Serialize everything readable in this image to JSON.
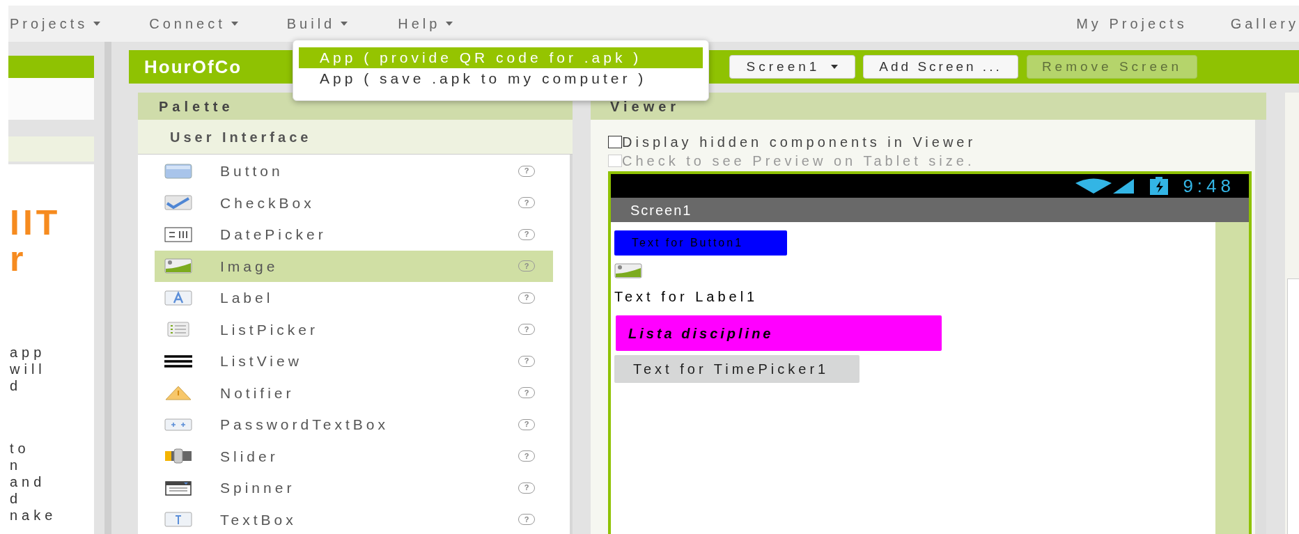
{
  "menu_bar": {
    "items": [
      {
        "label": "Projects"
      },
      {
        "label": "Connect"
      },
      {
        "label": "Build"
      },
      {
        "label": "Help"
      }
    ],
    "right_links": [
      {
        "label": "My Projects"
      },
      {
        "label": "Gallery"
      }
    ]
  },
  "build_menu": {
    "items": [
      {
        "label": "App ( provide QR code for .apk )",
        "selected": true
      },
      {
        "label": "App ( save .apk to my computer )",
        "selected": false
      }
    ]
  },
  "left_panel": {
    "heading_lines": [
      "IIT",
      "r"
    ],
    "text_lines": [
      "app",
      "will",
      "d",
      "to",
      "n",
      "and",
      "d",
      "nake"
    ]
  },
  "toolbar": {
    "project_name": "HourOfCo",
    "screen_dropdown": "Screen1",
    "buttons": [
      {
        "label": "Add Screen ...",
        "disabled": false
      },
      {
        "label": "Remove Screen",
        "disabled": true
      }
    ]
  },
  "palette": {
    "title": "Palette",
    "section": "User Interface",
    "items": [
      {
        "kind": "button",
        "label": "Button",
        "help": "?",
        "selected": false
      },
      {
        "kind": "checkbox",
        "label": "CheckBox",
        "help": "?",
        "selected": false
      },
      {
        "kind": "datepicker",
        "label": "DatePicker",
        "help": "?",
        "selected": false
      },
      {
        "kind": "image",
        "label": "Image",
        "help": "?",
        "selected": true
      },
      {
        "kind": "label",
        "label": "Label",
        "help": "?",
        "selected": false
      },
      {
        "kind": "listpicker",
        "label": "ListPicker",
        "help": "?",
        "selected": false
      },
      {
        "kind": "listview",
        "label": "ListView",
        "help": "?",
        "selected": false
      },
      {
        "kind": "notifier",
        "label": "Notifier",
        "help": "?",
        "selected": false
      },
      {
        "kind": "password",
        "label": "PasswordTextBox",
        "help": "?",
        "selected": false
      },
      {
        "kind": "slider",
        "label": "Slider",
        "help": "?",
        "selected": false
      },
      {
        "kind": "spinner",
        "label": "Spinner",
        "help": "?",
        "selected": false
      },
      {
        "kind": "textbox",
        "label": "TextBox",
        "help": "?",
        "selected": false
      }
    ]
  },
  "viewer": {
    "title": "Viewer",
    "options": [
      {
        "label": "Display hidden components in Viewer",
        "checked": false,
        "disabled": false
      },
      {
        "label": "Check to see Preview on Tablet size.",
        "checked": false,
        "disabled": true
      }
    ],
    "phone": {
      "time": "9:48",
      "screen_title": "Screen1",
      "components": [
        {
          "kind": "button",
          "text": "Text for Button1"
        },
        {
          "kind": "image"
        },
        {
          "kind": "label",
          "text": "Text for Label1"
        },
        {
          "kind": "listpicker",
          "text": "Lista discipline"
        },
        {
          "kind": "timepicker",
          "text": "Text for TimePicker1"
        }
      ]
    }
  }
}
